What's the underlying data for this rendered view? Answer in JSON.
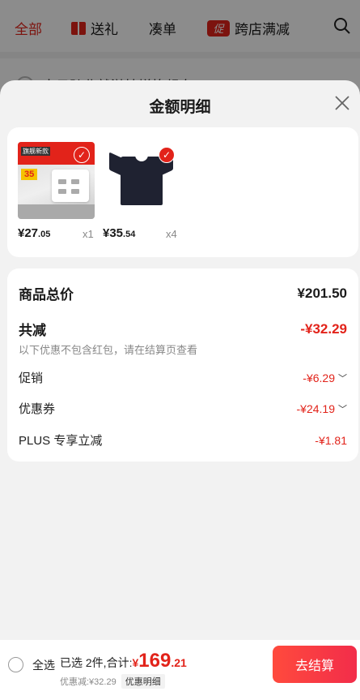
{
  "nav": {
    "tabs": [
      "全部",
      "送礼",
      "凑单",
      "跨店满减"
    ],
    "cu_badge": "促"
  },
  "background_row": {
    "text": "十日跨北就淤抹增换组东"
  },
  "sheet": {
    "title": "金额明细"
  },
  "products": [
    {
      "name": "charger",
      "tag": "旗舰新款",
      "promo": "35",
      "price_int": "¥27",
      "price_dec": ".05",
      "qty": "x1"
    },
    {
      "name": "tshirt",
      "price_int": "¥35",
      "price_dec": ".54",
      "qty": "x4"
    }
  ],
  "summary": {
    "total_label": "商品总价",
    "total_value": "¥201.50",
    "reduce_label": "共减",
    "reduce_value": "-¥32.29",
    "note": "以下优惠不包含红包，请在结算页查看",
    "promo_label": "促销",
    "promo_value": "-¥6.29",
    "coupon_label": "优惠券",
    "coupon_value": "-¥24.19",
    "plus_label": "PLUS 专享立减",
    "plus_value": "-¥1.81"
  },
  "bottom": {
    "select_all": "全选",
    "selected_text": "已选 2件,合计:",
    "currency": "¥",
    "total_int": "169",
    "total_dec": ".21",
    "discount_text": "优惠减:¥32.29",
    "detail_badge": "优惠明细",
    "checkout": "去结算"
  },
  "colors": {
    "accent": "#e2231a"
  }
}
